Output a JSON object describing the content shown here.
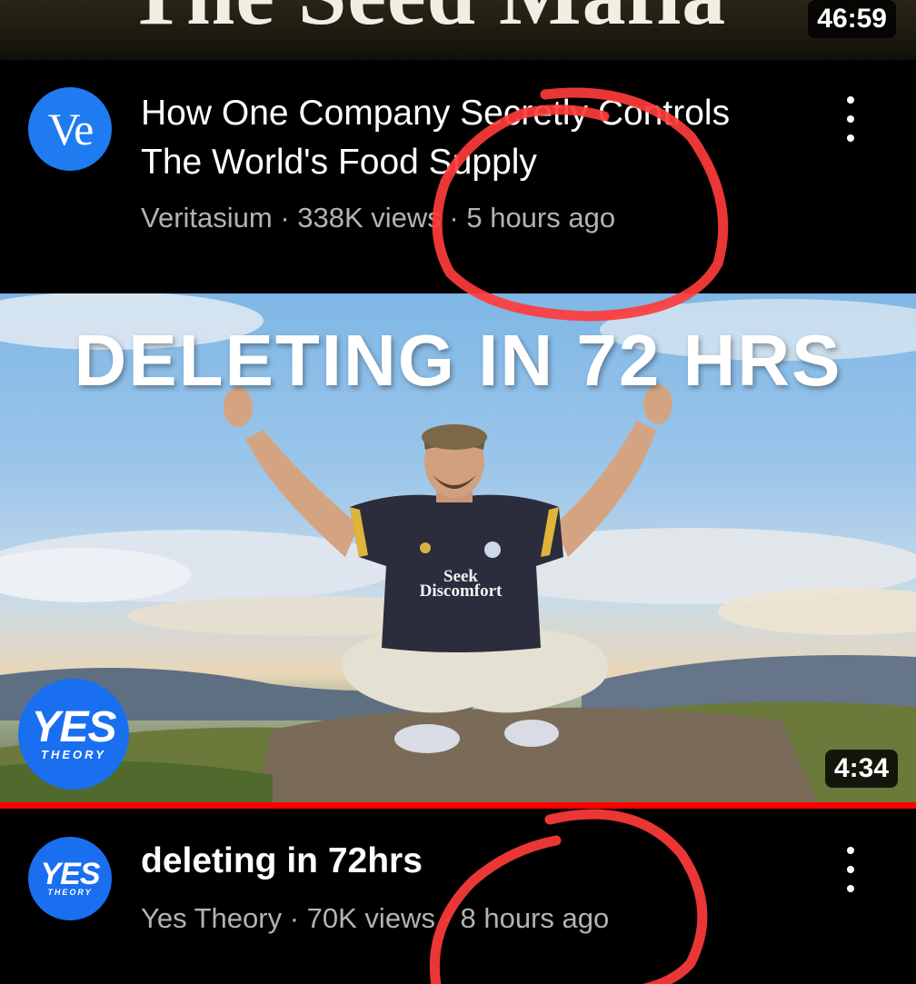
{
  "videos": [
    {
      "thumbnail_title": "The Seed Mafia",
      "duration": "46:59",
      "channel_initials": "Ve",
      "title": "How One Company Secretly Controls The World's Food Supply",
      "meta": "Veritasium · 338K views · 5 hours ago",
      "avatar_color": "#1f7bf0"
    },
    {
      "thumbnail_title": "DELETING IN 72 HRS",
      "thumbnail_shirt_text": "Seek Discomfort",
      "thumbnail_logo": "YES",
      "thumbnail_logo_sub": "THEORY",
      "duration": "4:34",
      "watch_progress": 1.0,
      "channel_logo": "YES",
      "channel_logo_sub": "THEORY",
      "title": "deleting in 72hrs",
      "meta": "Yes Theory · 70K views · 8 hours ago",
      "avatar_color": "#1a6ff0"
    }
  ],
  "icons": {
    "more_menu": "more-vertical-icon"
  },
  "colors": {
    "background": "#000000",
    "title_text": "#ffffff",
    "meta_text": "#b3b3b3",
    "progress": "#ff0000",
    "annotation": "#ff3b3b"
  }
}
